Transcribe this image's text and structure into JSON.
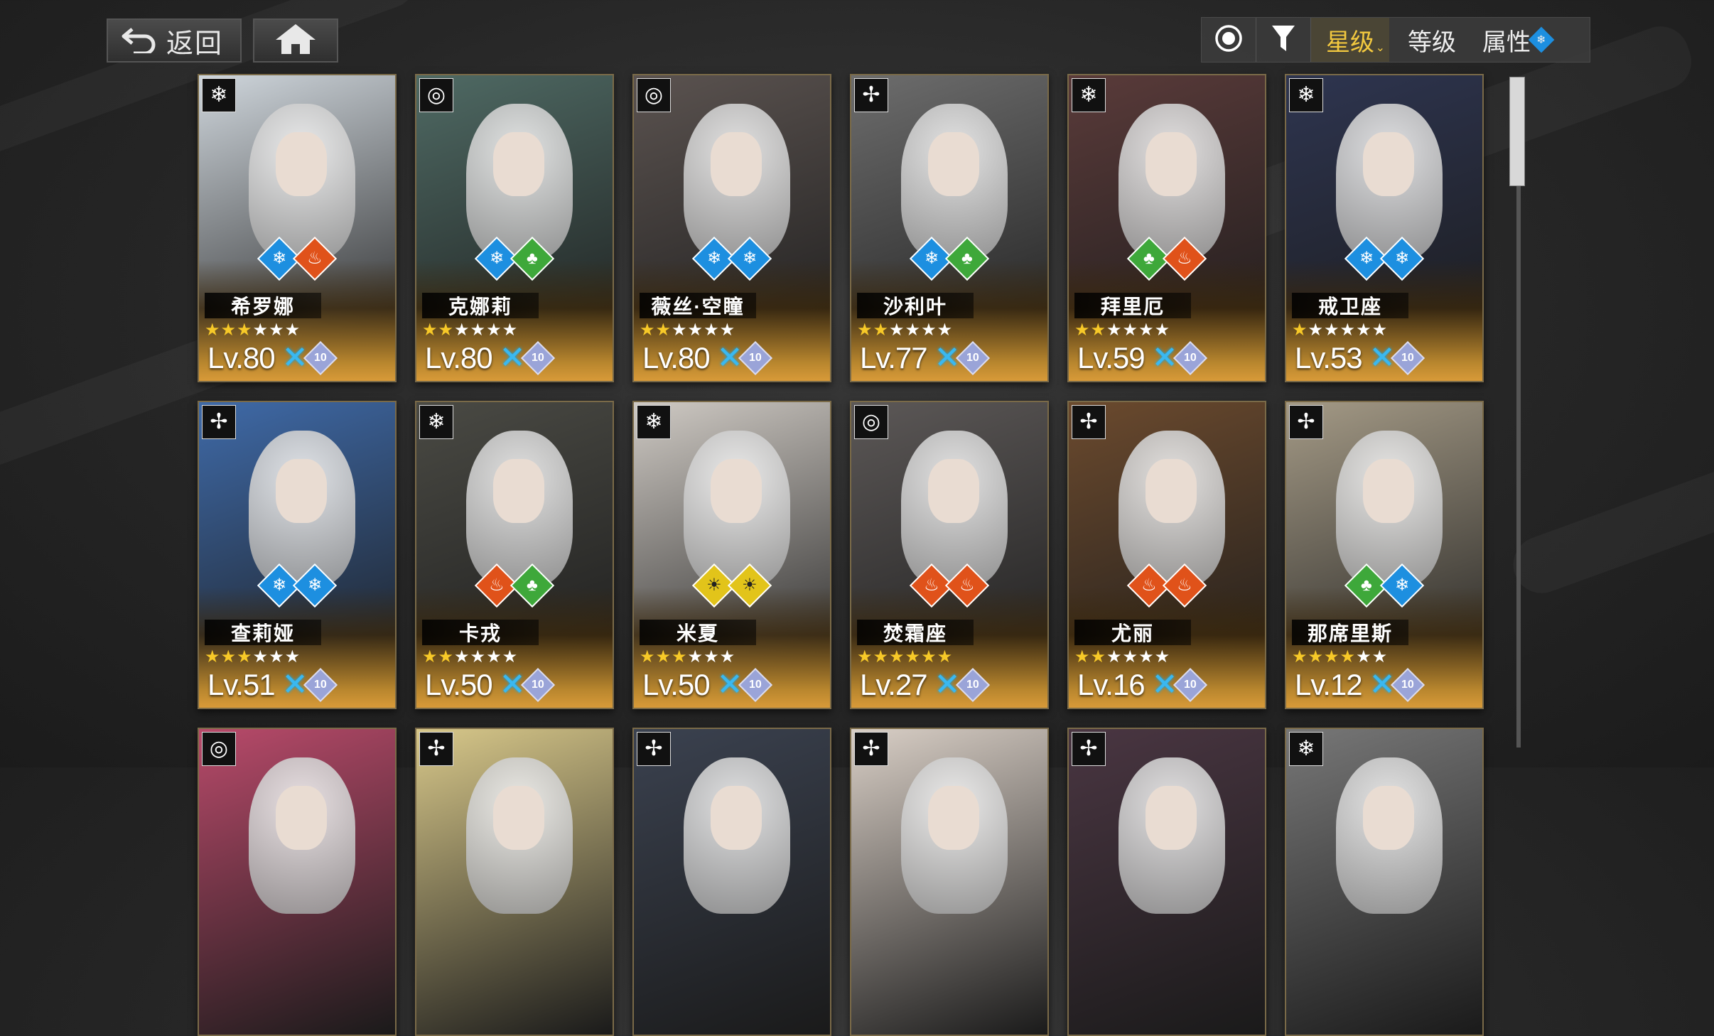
{
  "nav": {
    "back_label": "返回",
    "back_icon": "return-arrow-icon",
    "home_icon": "home-icon"
  },
  "sortbar": {
    "toggle_icon": "radio-circle-icon",
    "filter_icon": "filter-funnel-icon",
    "sort_star": "星级",
    "sort_level": "等级",
    "sort_attr": "属性",
    "attr_icon": "ice-snowflake-icon",
    "active_color": "#f3c93f"
  },
  "attr_colors": {
    "ice": "#1d8fe0",
    "fire": "#e0521a",
    "wood": "#3ea83a",
    "gold": "#e2c41a"
  },
  "characters": [
    {
      "name": "希罗娜",
      "class": "snowflake",
      "attrs": [
        "ice",
        "fire"
      ],
      "stars": 3,
      "max_stars": 6,
      "level": "Lv.80",
      "rank": "10",
      "art": "#cfd6dc"
    },
    {
      "name": "克娜莉",
      "class": "target",
      "attrs": [
        "ice",
        "wood"
      ],
      "stars": 2,
      "max_stars": 6,
      "level": "Lv.80",
      "rank": "10",
      "art": "#4f6a64"
    },
    {
      "name": "薇丝·空瞳",
      "class": "target",
      "attrs": [
        "ice",
        "ice"
      ],
      "stars": 2,
      "max_stars": 6,
      "level": "Lv.80",
      "rank": "10",
      "art": "#5b5350"
    },
    {
      "name": "沙利叶",
      "class": "pinwheel",
      "attrs": [
        "ice",
        "wood"
      ],
      "stars": 2,
      "max_stars": 6,
      "level": "Lv.77",
      "rank": "10",
      "art": "#6d6d6d"
    },
    {
      "name": "拜里厄",
      "class": "snowflake",
      "attrs": [
        "wood",
        "fire"
      ],
      "stars": 2,
      "max_stars": 6,
      "level": "Lv.59",
      "rank": "10",
      "art": "#5a3b3a"
    },
    {
      "name": "戒卫座",
      "class": "snowflake",
      "attrs": [
        "ice",
        "ice"
      ],
      "stars": 1,
      "max_stars": 6,
      "level": "Lv.53",
      "rank": "10",
      "art": "#2e3550"
    },
    {
      "name": "查莉娅",
      "class": "pinwheel",
      "attrs": [
        "ice",
        "ice"
      ],
      "stars": 3,
      "max_stars": 6,
      "level": "Lv.51",
      "rank": "10",
      "art": "#3f6aa8"
    },
    {
      "name": "卡戎",
      "class": "snowflake",
      "attrs": [
        "fire",
        "wood"
      ],
      "stars": 2,
      "max_stars": 6,
      "level": "Lv.50",
      "rank": "10",
      "art": "#4a4a44"
    },
    {
      "name": "米夏",
      "class": "snowflake",
      "attrs": [
        "gold",
        "gold"
      ],
      "stars": 3,
      "max_stars": 6,
      "level": "Lv.50",
      "rank": "10",
      "art": "#cfcac4"
    },
    {
      "name": "焚霜座",
      "class": "target",
      "attrs": [
        "fire",
        "fire"
      ],
      "stars": 6,
      "max_stars": 6,
      "level": "Lv.27",
      "rank": "10",
      "art": "#5c5857"
    },
    {
      "name": "尤丽",
      "class": "pinwheel",
      "attrs": [
        "fire",
        "fire"
      ],
      "stars": 2,
      "max_stars": 6,
      "level": "Lv.16",
      "rank": "10",
      "art": "#6b4a2e"
    },
    {
      "name": "那席里斯",
      "class": "pinwheel",
      "attrs": [
        "wood",
        "ice"
      ],
      "stars": 4,
      "max_stars": 6,
      "level": "Lv.12",
      "rank": "10",
      "art": "#a49a86"
    }
  ],
  "partial_row": [
    {
      "class": "target",
      "art": "#b84a6a"
    },
    {
      "class": "pinwheel",
      "art": "#d8c88a"
    },
    {
      "class": "pinwheel",
      "art": "#3b4250"
    },
    {
      "class": "pinwheel",
      "art": "#d9cfc6"
    },
    {
      "class": "pinwheel",
      "art": "#4a3642"
    },
    {
      "class": "snowflake",
      "art": "#777777"
    }
  ]
}
